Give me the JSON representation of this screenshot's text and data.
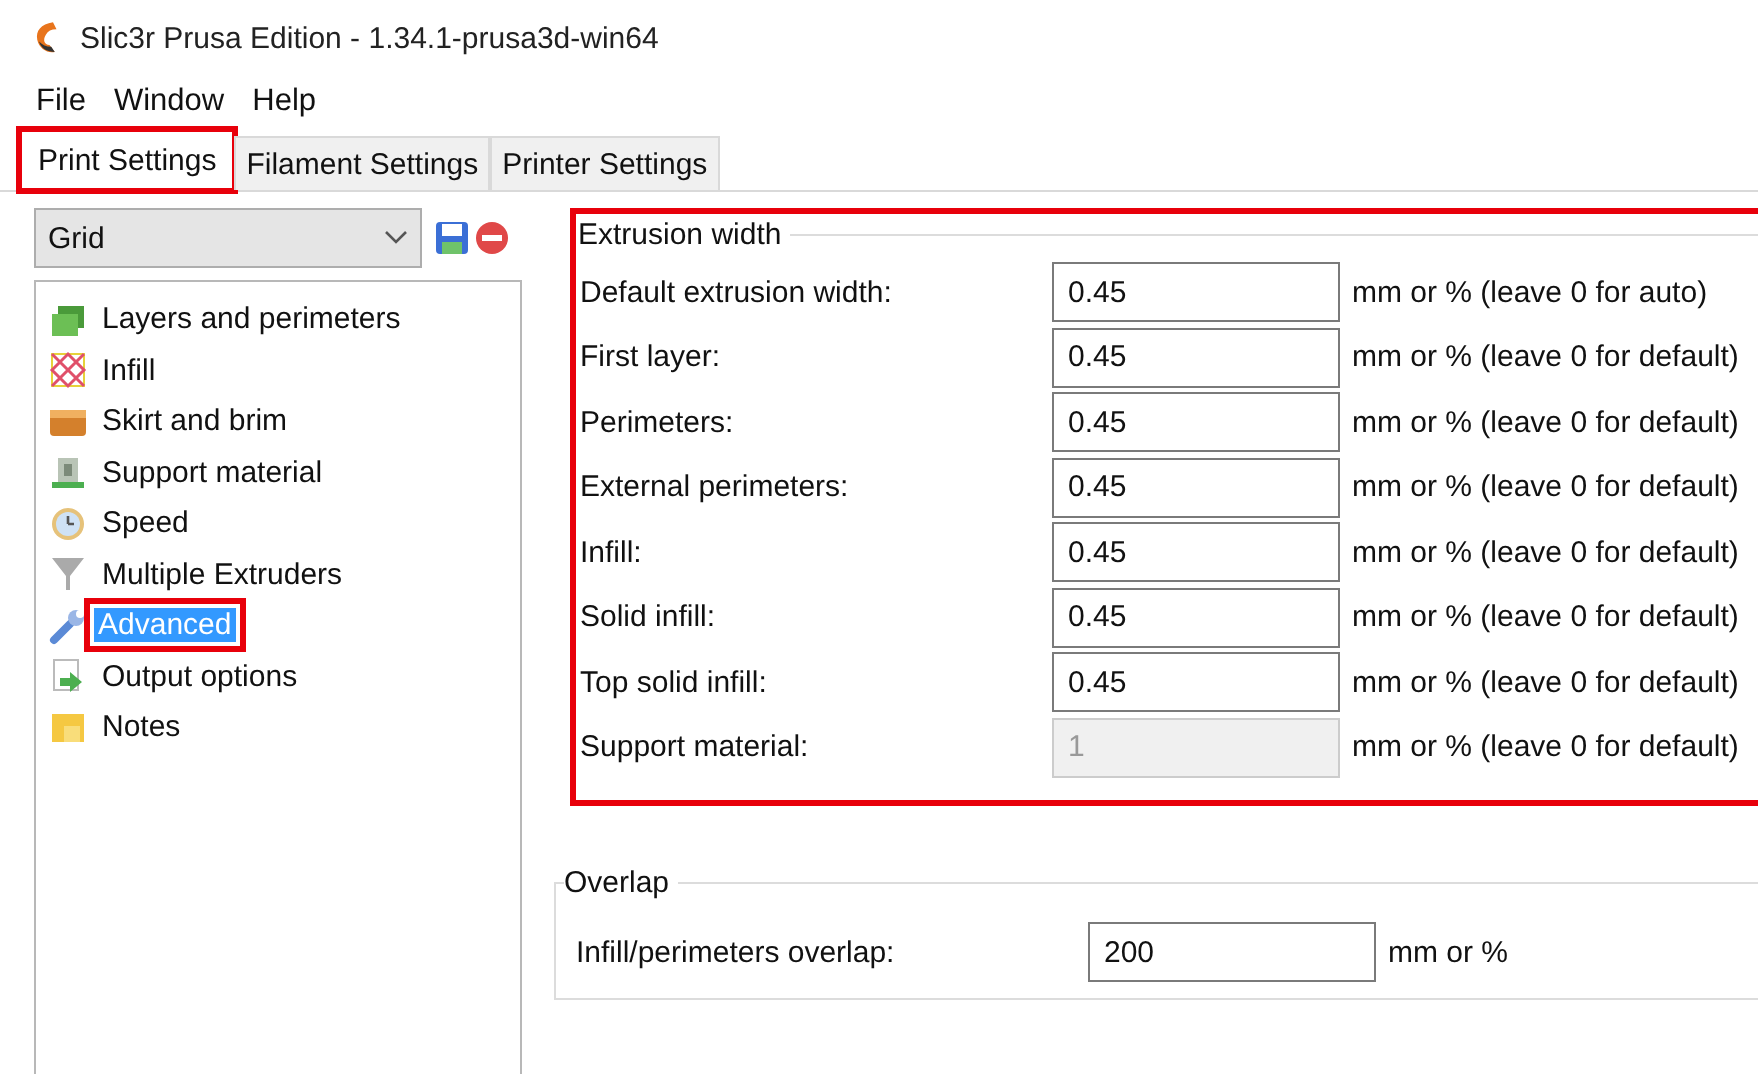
{
  "window": {
    "title": "Slic3r Prusa Edition - 1.34.1-prusa3d-win64"
  },
  "menu": [
    "File",
    "Window",
    "Help"
  ],
  "tabs": [
    {
      "label": "Print Settings",
      "selected": true,
      "highlighted": true
    },
    {
      "label": "Filament Settings",
      "selected": false,
      "highlighted": false
    },
    {
      "label": "Printer Settings",
      "selected": false,
      "highlighted": false
    }
  ],
  "preset": {
    "value": "Grid"
  },
  "sidebar": {
    "items": [
      {
        "label": "Layers and perimeters",
        "selected": false,
        "highlighted": false
      },
      {
        "label": "Infill",
        "selected": false,
        "highlighted": false
      },
      {
        "label": "Skirt and brim",
        "selected": false,
        "highlighted": false
      },
      {
        "label": "Support material",
        "selected": false,
        "highlighted": false
      },
      {
        "label": "Speed",
        "selected": false,
        "highlighted": false
      },
      {
        "label": "Multiple Extruders",
        "selected": false,
        "highlighted": false
      },
      {
        "label": "Advanced",
        "selected": true,
        "highlighted": true
      },
      {
        "label": "Output options",
        "selected": false,
        "highlighted": false
      },
      {
        "label": "Notes",
        "selected": false,
        "highlighted": false
      }
    ]
  },
  "groups": [
    {
      "title": "Extrusion width",
      "highlighted": true,
      "rows": [
        {
          "label": "Default extrusion width:",
          "value": "0.45",
          "unit": "mm or % (leave 0 for auto)",
          "disabled": false
        },
        {
          "label": "First layer:",
          "value": "0.45",
          "unit": "mm or % (leave 0 for default)",
          "disabled": false
        },
        {
          "label": "Perimeters:",
          "value": "0.45",
          "unit": "mm or % (leave 0 for default)",
          "disabled": false
        },
        {
          "label": "External perimeters:",
          "value": "0.45",
          "unit": "mm or % (leave 0 for default)",
          "disabled": false
        },
        {
          "label": "Infill:",
          "value": "0.45",
          "unit": "mm or % (leave 0 for default)",
          "disabled": false
        },
        {
          "label": "Solid infill:",
          "value": "0.45",
          "unit": "mm or % (leave 0 for default)",
          "disabled": false
        },
        {
          "label": "Top solid infill:",
          "value": "0.45",
          "unit": "mm or % (leave 0 for default)",
          "disabled": false
        },
        {
          "label": "Support material:",
          "value": "1",
          "unit": "mm or % (leave 0 for default)",
          "disabled": true
        }
      ]
    },
    {
      "title": "Overlap",
      "highlighted": false,
      "rows": [
        {
          "label": "Infill/perimeters overlap:",
          "value": "200",
          "unit": "mm or %",
          "disabled": false
        }
      ]
    }
  ]
}
